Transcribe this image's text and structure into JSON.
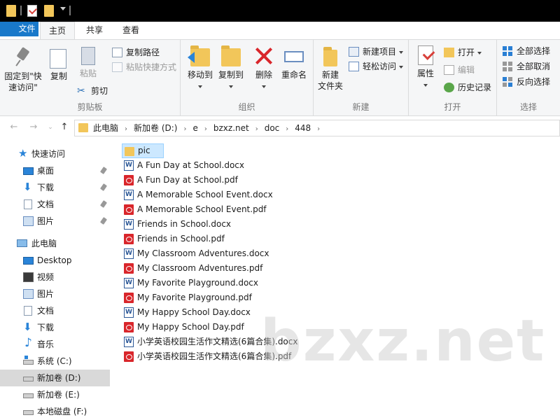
{
  "ribbon_tabs": {
    "file": "文件",
    "home": "主页",
    "share": "共享",
    "view": "查看"
  },
  "ribbon": {
    "clipboard": {
      "label": "剪贴板",
      "pin_quick_line1": "固定到\"快",
      "pin_quick_line2": "速访问\"",
      "copy": "复制",
      "paste": "粘贴",
      "copy_path": "复制路径",
      "paste_shortcut": "粘贴快捷方式",
      "cut": "剪切"
    },
    "organize": {
      "label": "组织",
      "move_to": "移动到",
      "copy_to": "复制到",
      "delete": "删除",
      "rename": "重命名"
    },
    "new": {
      "label": "新建",
      "new_folder_line1": "新建",
      "new_folder_line2": "文件夹",
      "new_item": "新建项目",
      "easy_access": "轻松访问"
    },
    "open": {
      "label": "打开",
      "properties": "属性",
      "open": "打开",
      "edit": "编辑",
      "history": "历史记录"
    },
    "select": {
      "label": "选择",
      "select_all": "全部选择",
      "select_none": "全部取消",
      "invert": "反向选择"
    }
  },
  "address": {
    "crumbs": [
      "此电脑",
      "新加卷 (D:)",
      "e",
      "bzxz.net",
      "doc",
      "448"
    ]
  },
  "sidebar": {
    "quick_access": "快速访问",
    "desktop": "桌面",
    "downloads": "下载",
    "documents": "文档",
    "pictures": "图片",
    "this_pc": "此电脑",
    "pc_desktop": "Desktop",
    "videos": "视频",
    "pc_pictures": "图片",
    "pc_documents": "文档",
    "pc_downloads": "下载",
    "music": "音乐",
    "drive_c": "系统 (C:)",
    "drive_d": "新加卷 (D:)",
    "drive_e": "新加卷 (E:)",
    "drive_f": "本地磁盘 (F:)"
  },
  "files": [
    {
      "name": "pic",
      "type": "folder"
    },
    {
      "name": "A Fun Day at School.docx",
      "type": "docx"
    },
    {
      "name": "A Fun Day at School.pdf",
      "type": "pdf"
    },
    {
      "name": "A Memorable School Event.docx",
      "type": "docx"
    },
    {
      "name": "A Memorable School Event.pdf",
      "type": "pdf"
    },
    {
      "name": "Friends in School.docx",
      "type": "docx"
    },
    {
      "name": "Friends in School.pdf",
      "type": "pdf"
    },
    {
      "name": "My Classroom Adventures.docx",
      "type": "docx"
    },
    {
      "name": "My Classroom Adventures.pdf",
      "type": "pdf"
    },
    {
      "name": "My Favorite Playground.docx",
      "type": "docx"
    },
    {
      "name": "My Favorite Playground.pdf",
      "type": "pdf"
    },
    {
      "name": "My Happy School Day.docx",
      "type": "docx"
    },
    {
      "name": "My Happy School Day.pdf",
      "type": "pdf"
    },
    {
      "name": "小学英语校园生活作文精选(6篇合集).docx",
      "type": "docx"
    },
    {
      "name": "小学英语校园生活作文精选(6篇合集).pdf",
      "type": "pdf"
    }
  ],
  "watermark": "bzxz.net",
  "colors": {
    "accent": "#1979ca",
    "selection": "#cce8ff",
    "sidebar_selected": "#d9d9d9"
  }
}
